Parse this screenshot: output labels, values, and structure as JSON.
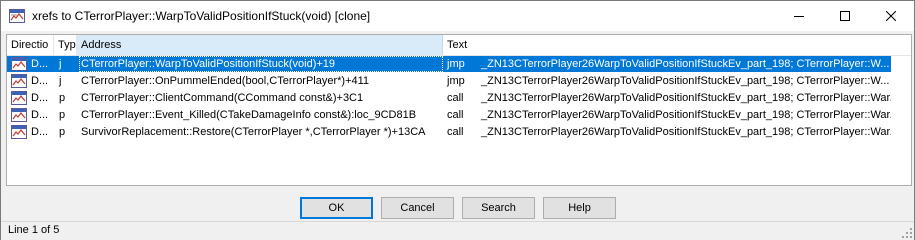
{
  "window": {
    "title": "xrefs to CTerrorPlayer::WarpToValidPositionIfStuck(void) [clone]",
    "icon": "xrefs-window-icon"
  },
  "titlebar_buttons": {
    "minimize_icon": "minimize-icon",
    "maximize_icon": "maximize-icon",
    "close_icon": "close-icon"
  },
  "columns": {
    "direction": "Directio",
    "type": "Typ",
    "address": "Address",
    "text": "Text"
  },
  "rows": [
    {
      "direction": "D...",
      "type": "j",
      "address": "CTerrorPlayer::WarpToValidPositionIfStuck(void)+19",
      "instruction": "jmp",
      "text": "_ZN13CTerrorPlayer26WarpToValidPositionIfStuckEv_part_198; CTerrorPlayer::W...",
      "selected": true
    },
    {
      "direction": "D...",
      "type": "j",
      "address": "CTerrorPlayer::OnPummelEnded(bool,CTerrorPlayer*)+411",
      "instruction": "jmp",
      "text": "_ZN13CTerrorPlayer26WarpToValidPositionIfStuckEv_part_198; CTerrorPlayer::W...",
      "selected": false
    },
    {
      "direction": "D...",
      "type": "p",
      "address": "CTerrorPlayer::ClientCommand(CCommand const&)+3C1",
      "instruction": "call",
      "text": "_ZN13CTerrorPlayer26WarpToValidPositionIfStuckEv_part_198; CTerrorPlayer::War...",
      "selected": false
    },
    {
      "direction": "D...",
      "type": "p",
      "address": "CTerrorPlayer::Event_Killed(CTakeDamageInfo const&):loc_9CD81B",
      "instruction": "call",
      "text": "_ZN13CTerrorPlayer26WarpToValidPositionIfStuckEv_part_198; CTerrorPlayer::War...",
      "selected": false
    },
    {
      "direction": "D...",
      "type": "p",
      "address": "SurvivorReplacement::Restore(CTerrorPlayer *,CTerrorPlayer *)+13CA",
      "instruction": "call",
      "text": "_ZN13CTerrorPlayer26WarpToValidPositionIfStuckEv_part_198; CTerrorPlayer::War...",
      "selected": false
    }
  ],
  "buttons": {
    "ok": "OK",
    "cancel": "Cancel",
    "search": "Search",
    "help": "Help"
  },
  "status": {
    "text": "Line 1 of 5"
  },
  "colors": {
    "selection": "#0078d7",
    "active_header": "#d9ebf9"
  }
}
